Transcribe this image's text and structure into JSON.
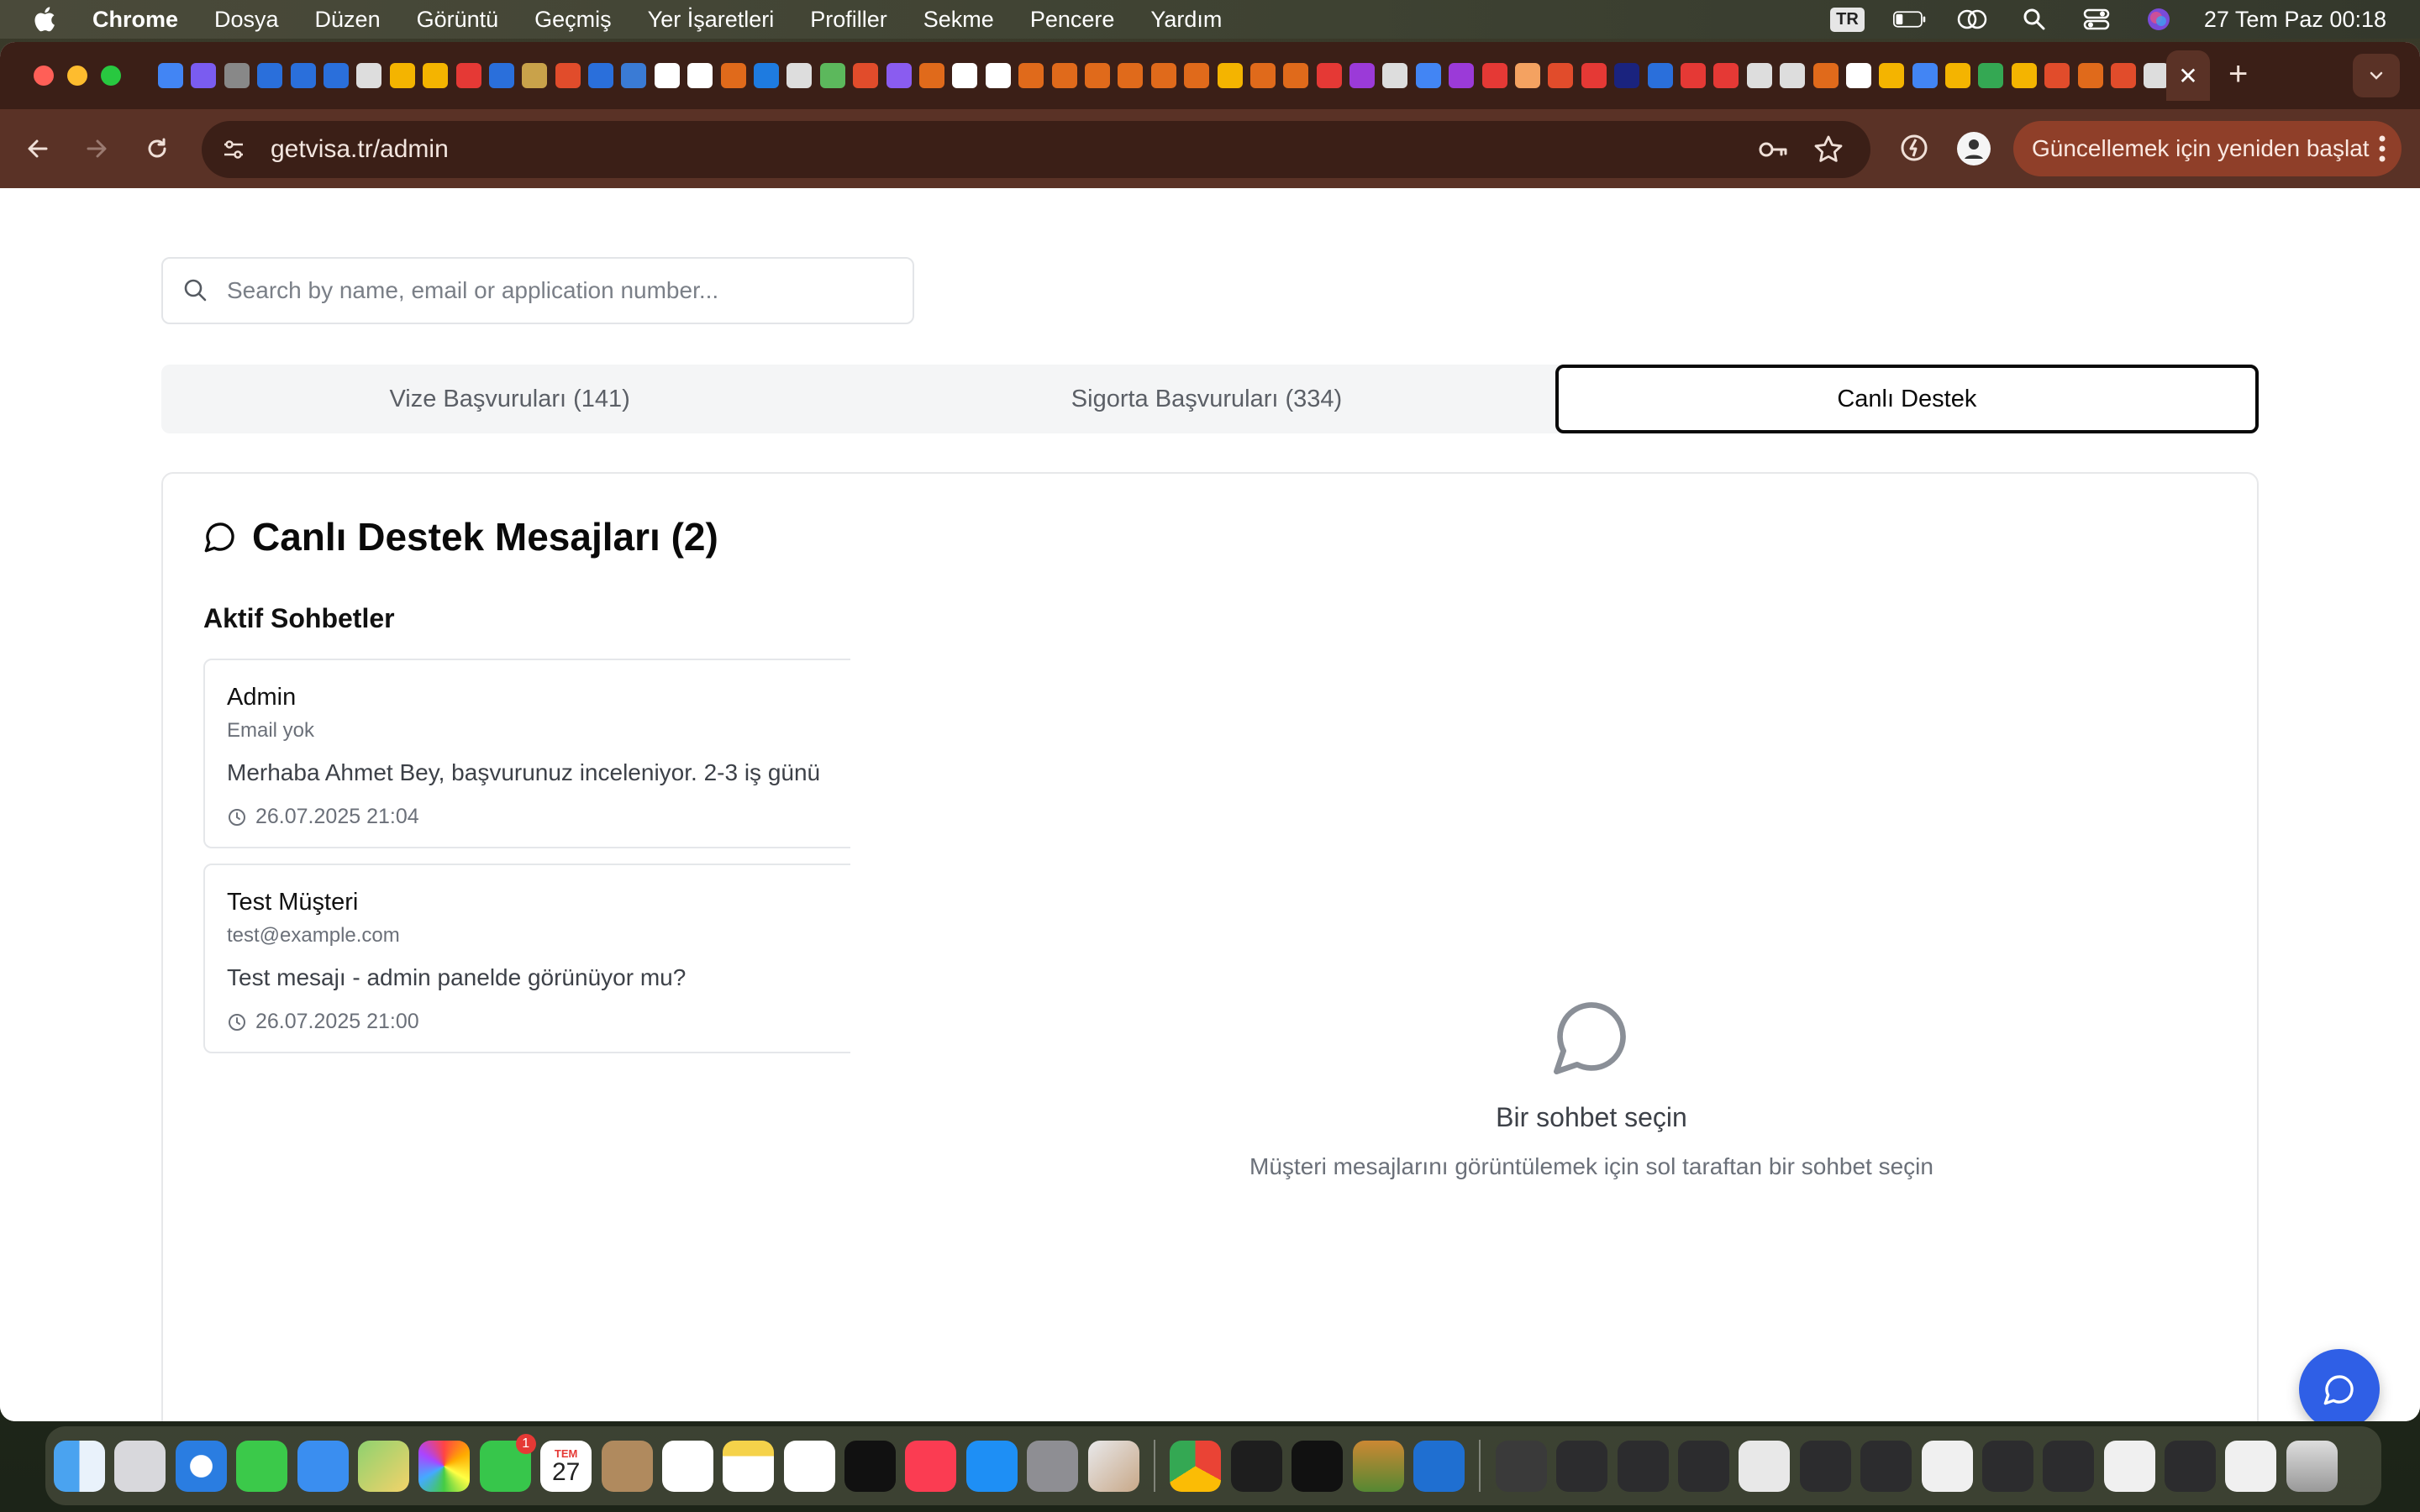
{
  "menubar": {
    "app_name": "Chrome",
    "items": [
      "Dosya",
      "Düzen",
      "Görüntü",
      "Geçmiş",
      "Yer İşaretleri",
      "Profiller",
      "Sekme",
      "Pencere",
      "Yardım"
    ],
    "input_source": "TR",
    "datetime": "27 Tem Paz  00:18"
  },
  "browser": {
    "url": "getvisa.tr/admin",
    "update_button": "Güncellemek için yeniden başlat",
    "active_tab_close": "✕",
    "new_tab": "+"
  },
  "search": {
    "placeholder": "Search by name, email or application number..."
  },
  "tabs": {
    "visa": "Vize Başvuruları (141)",
    "insurance": "Sigorta Başvuruları (334)",
    "support": "Canlı Destek"
  },
  "support_panel": {
    "title": "Canlı Destek Mesajları (2)",
    "section_title": "Aktif Sohbetler",
    "conversations": [
      {
        "name": "Admin",
        "email": "Email yok",
        "message": "Merhaba Ahmet Bey, başvurunuz inceleniyor. 2-3 iş günü",
        "time": "26.07.2025 21:04"
      },
      {
        "name": "Test Müşteri",
        "email": "test@example.com",
        "message": "Test mesajı - admin panelde görünüyor mu?",
        "time": "26.07.2025 21:00"
      }
    ],
    "empty_title": "Bir sohbet seçin",
    "empty_subtitle": "Müşteri mesajlarını görüntülemek için sol taraftan bir sohbet seçin"
  },
  "dock": {
    "calendar_day": "27",
    "calendar_month": "TEM",
    "facetime_badge": "1"
  },
  "colors": {
    "tab_strip": "#3b1f17",
    "toolbar": "#5a3226",
    "update_pill": "#8f3f29",
    "fab": "#2f5fe6",
    "active_tab_border": "#0a0a0a"
  }
}
